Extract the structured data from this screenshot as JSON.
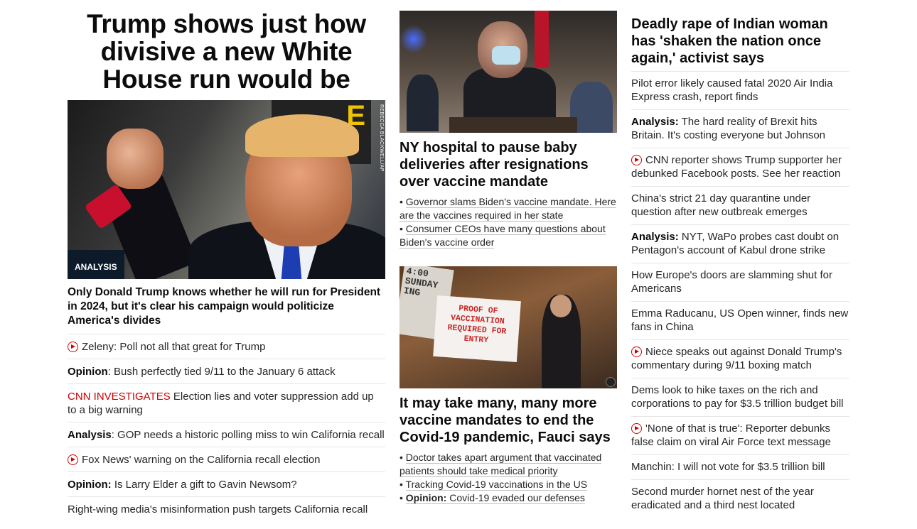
{
  "col1": {
    "headline": "Trump shows just how divisive a new White House run would be",
    "hero_tag": "ANALYSIS",
    "hero_credit": "REBECCA BLACKWELL/AP",
    "hero_caption": "Only Donald Trump knows whether he will run for President in 2024, but it's clear his campaign would politicize America's divides",
    "items": [
      {
        "video": true,
        "prefix": "",
        "prefix_style": "",
        "text": "Zeleny: Poll not all that great for Trump"
      },
      {
        "video": false,
        "prefix": "Opinion",
        "prefix_style": "bold",
        "text": ": Bush perfectly tied 9/11 to the January 6 attack"
      },
      {
        "video": false,
        "prefix": "CNN INVESTIGATES",
        "prefix_style": "red",
        "text": " Election lies and voter suppression add up to a big warning"
      },
      {
        "video": false,
        "prefix": "Analysis",
        "prefix_style": "bold",
        "text": ": GOP needs a historic polling miss to win California recall"
      },
      {
        "video": true,
        "prefix": "",
        "prefix_style": "",
        "text": "Fox News' warning on the California recall election"
      },
      {
        "video": false,
        "prefix": "Opinion:",
        "prefix_style": "bold",
        "text": " Is Larry Elder a gift to Gavin Newsom?"
      },
      {
        "video": false,
        "prefix": "",
        "prefix_style": "",
        "text": "Right-wing media's misinformation push targets California recall"
      }
    ]
  },
  "col2": {
    "story1": {
      "headline": "NY hospital to pause baby deliveries after resignations over vaccine mandate",
      "bullets": [
        {
          "prefix": "",
          "text": "Governor slams Biden's vaccine mandate. Here are the vaccines required in her state"
        },
        {
          "prefix": "",
          "text": "Consumer CEOs have many questions about Biden's vaccine order"
        }
      ]
    },
    "story2": {
      "sign_text": "PROOF OF VACCINATION REQUIRED FOR ENTRY",
      "board_text": "4:00 SUNDAY ING",
      "headline": "It may take many, many more vaccine mandates to end the Covid-19 pandemic, Fauci says",
      "bullets": [
        {
          "prefix": "",
          "text": "Doctor takes apart argument that vaccinated patients should take medical priority"
        },
        {
          "prefix": "",
          "text": "Tracking Covid-19 vaccinations in the US"
        },
        {
          "prefix": "Opinion:",
          "text": " Covid-19 evaded our defenses"
        }
      ]
    }
  },
  "col3": {
    "headline": "Deadly rape of Indian woman has 'shaken the nation once again,' activist says",
    "items": [
      {
        "video": false,
        "prefix": "",
        "text": "Pilot error likely caused fatal 2020 Air India Express crash, report finds"
      },
      {
        "video": false,
        "prefix": "Analysis:",
        "text": " The hard reality of Brexit hits Britain. It's costing everyone but Johnson"
      },
      {
        "video": true,
        "prefix": "",
        "text": "CNN reporter shows Trump supporter her debunked Facebook posts. See her reaction"
      },
      {
        "video": false,
        "prefix": "",
        "text": "China's strict 21 day quarantine under question after new outbreak emerges"
      },
      {
        "video": false,
        "prefix": "Analysis:",
        "text": " NYT, WaPo probes cast doubt on Pentagon's account of Kabul drone strike"
      },
      {
        "video": false,
        "prefix": "",
        "text": "How Europe's doors are slamming shut for Americans"
      },
      {
        "video": false,
        "prefix": "",
        "text": "Emma Raducanu, US Open winner, finds new fans in China"
      },
      {
        "video": true,
        "prefix": "",
        "text": "Niece speaks out against Donald Trump's commentary during 9/11 boxing match"
      },
      {
        "video": false,
        "prefix": "",
        "text": "Dems look to hike taxes on the rich and corporations to pay for $3.5 trillion budget bill"
      },
      {
        "video": true,
        "prefix": "",
        "text": "'None of that is true': Reporter debunks false claim on viral Air Force text message"
      },
      {
        "video": false,
        "prefix": "",
        "text": "Manchin: I will not vote for $3.5 trillion bill"
      },
      {
        "video": false,
        "prefix": "",
        "text": "Second murder hornet nest of the year eradicated and a third nest located"
      }
    ]
  },
  "colors": {
    "accent_red": "#cc0000",
    "tag_bg": "#0c1a2a",
    "divider": "#e6e6e6"
  },
  "icons": {
    "video": "play-circle-icon"
  }
}
